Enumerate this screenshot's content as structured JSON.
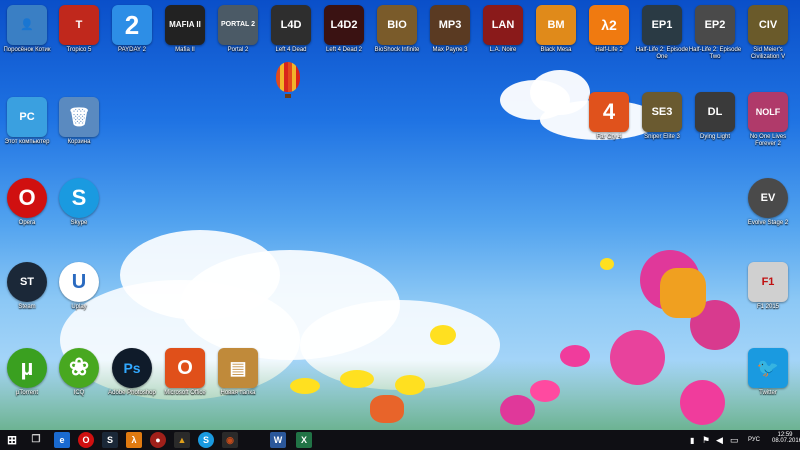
{
  "desktop": {
    "icons": [
      {
        "label": "Поросёнок Котик",
        "glyph": "👤",
        "color": "#3a7fc4"
      },
      {
        "label": "Tropico 5",
        "glyph": "T",
        "color": "#c0281c"
      },
      {
        "label": "PAYDAY 2",
        "glyph": "2",
        "color": "#2d8ee6"
      },
      {
        "label": "Mafia II",
        "glyph": "MAFIA II",
        "color": "#222222"
      },
      {
        "label": "Portal 2",
        "glyph": "PORTAL 2",
        "color": "#4b5a66"
      },
      {
        "label": "Left 4 Dead",
        "glyph": "L4D",
        "color": "#2e2e2e"
      },
      {
        "label": "Left 4 Dead 2",
        "glyph": "L4D2",
        "color": "#3a1212"
      },
      {
        "label": "BioShock Infinite",
        "glyph": "BIO",
        "color": "#7a5b2a"
      },
      {
        "label": "Max Payne 3",
        "glyph": "MP3",
        "color": "#5a3a22"
      },
      {
        "label": "L.A. Noire",
        "glyph": "LAN",
        "color": "#8a1a1a"
      },
      {
        "label": "Black Mesa",
        "glyph": "BM",
        "color": "#e08a1a"
      },
      {
        "label": "Half-Life 2",
        "glyph": "λ2",
        "color": "#f07a10"
      },
      {
        "label": "Half-Life 2: Episode One",
        "glyph": "EP1",
        "color": "#2a3a44"
      },
      {
        "label": "Half-Life 2: Episode Two",
        "glyph": "EP2",
        "color": "#4a4a4a"
      },
      {
        "label": "Sid Meier's Civilization V",
        "glyph": "CIV",
        "color": "#6a5a2a"
      },
      {
        "label": "Этот компьютер",
        "glyph": "PC",
        "color": "#3aa0e0"
      },
      {
        "label": "Корзина",
        "glyph": "🗑",
        "color": "#5a8ac0"
      },
      {
        "label": "Far Cry 4",
        "glyph": "4",
        "color": "#e0521c"
      },
      {
        "label": "Sniper Elite 3",
        "glyph": "SE3",
        "color": "#6a5a30"
      },
      {
        "label": "Dying Light",
        "glyph": "DL",
        "color": "#3a3a3a"
      },
      {
        "label": "No One Lives Forever 2",
        "glyph": "NOLF",
        "color": "#b03a6a"
      },
      {
        "label": "Opera",
        "glyph": "O",
        "color": "#d01010"
      },
      {
        "label": "Skype",
        "glyph": "S",
        "color": "#1a9ae0"
      },
      {
        "label": "Evolve Stage 2",
        "glyph": "EV",
        "color": "#4a4a4a"
      },
      {
        "label": "Steam",
        "glyph": "ST",
        "color": "#1b2838"
      },
      {
        "label": "Uplay",
        "glyph": "U",
        "color": "#2a6ac0"
      },
      {
        "label": "F1 2015",
        "glyph": "F1",
        "color": "#d0d0d0"
      },
      {
        "label": "µTorrent",
        "glyph": "µ",
        "color": "#3aa020"
      },
      {
        "label": "ICQ",
        "glyph": "❀",
        "color": "#48a820"
      },
      {
        "label": "Adobe Photoshop",
        "glyph": "Ps",
        "color": "#0f1b2a"
      },
      {
        "label": "Microsoft Office",
        "glyph": "O",
        "color": "#e0501a"
      },
      {
        "label": "Новая папка",
        "glyph": "▤",
        "color": "#c08a3a"
      },
      {
        "label": "Twitter",
        "glyph": "🐦",
        "color": "#1a9ae0"
      }
    ]
  },
  "taskbar": {
    "start": "⊞",
    "task_view": "❐",
    "apps": [
      {
        "name": "Edge",
        "glyph": "e",
        "color": "#1a6ad0"
      },
      {
        "name": "Opera",
        "glyph": "O",
        "color": "#d01010"
      },
      {
        "name": "Steam",
        "glyph": "S",
        "color": "#1b2838"
      },
      {
        "name": "Half-Life",
        "glyph": "λ",
        "color": "#e07a10"
      },
      {
        "name": "Game 1",
        "glyph": "●",
        "color": "#a0201a"
      },
      {
        "name": "Game 2",
        "glyph": "▲",
        "color": "#e0a01a"
      },
      {
        "name": "Skype",
        "glyph": "S",
        "color": "#1a9ae0"
      },
      {
        "name": "Game 3",
        "glyph": "◉",
        "color": "#c04a1a"
      },
      {
        "name": "Word",
        "glyph": "W",
        "color": "#2b579a"
      },
      {
        "name": "Excel",
        "glyph": "X",
        "color": "#217346"
      }
    ],
    "tray": {
      "language": "РУС",
      "time": "12:59",
      "date": "08.07.2016"
    }
  }
}
